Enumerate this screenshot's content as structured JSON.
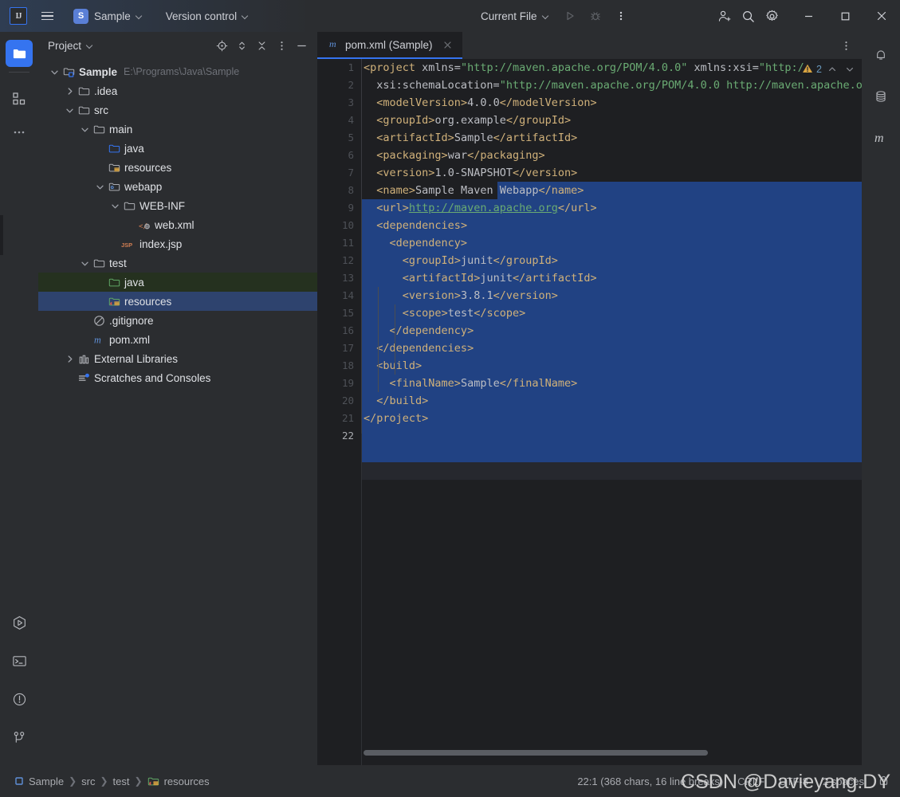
{
  "titlebar": {
    "logo_icon": "intellij-idea-logo",
    "menu_icon": "hamburger-menu-icon",
    "project_badge": "S",
    "project_name": "Sample",
    "version_control": "Version control",
    "run_config": "Current File",
    "run_icon": "run-icon",
    "debug_icon": "debug-icon",
    "more_icon": "more-vertical-icon",
    "add_user_icon": "add-user-icon",
    "search_icon": "search-icon",
    "settings_icon": "gear-icon",
    "minimize_icon": "minimize-icon",
    "maximize_icon": "maximize-icon",
    "close_icon": "close-icon"
  },
  "left_rail": {
    "top": [
      {
        "name": "project",
        "icon": "folder-icon",
        "active": true
      },
      {
        "name": "structure",
        "icon": "structure-squares-icon",
        "active": false
      },
      {
        "name": "more-tools",
        "icon": "more-horizontal-icon",
        "active": false
      }
    ],
    "bottom": [
      {
        "name": "run",
        "icon": "run-hexagon-icon"
      },
      {
        "name": "terminal",
        "icon": "terminal-icon"
      },
      {
        "name": "problems",
        "icon": "problems-warning-icon"
      },
      {
        "name": "version-control",
        "icon": "git-branch-icon"
      }
    ]
  },
  "project_panel": {
    "title": "Project",
    "title_chevron": "chevron-down-icon",
    "actions": [
      {
        "name": "select-opened-file",
        "icon": "crosshair-icon"
      },
      {
        "name": "expand-collapse",
        "icon": "expand-collapse-icon"
      },
      {
        "name": "collapse-all",
        "icon": "collapse-all-icon"
      },
      {
        "name": "options",
        "icon": "more-vertical-icon"
      },
      {
        "name": "hide",
        "icon": "minimize-icon"
      }
    ],
    "tree": [
      {
        "label": "Sample",
        "sub": "E:\\Programs\\Java\\Sample",
        "indent": 0,
        "arrow": "down",
        "icon": "module-folder-icon",
        "bold": true,
        "state": ""
      },
      {
        "label": ".idea",
        "sub": "",
        "indent": 1,
        "arrow": "right",
        "icon": "folder-icon",
        "bold": false,
        "state": ""
      },
      {
        "label": "src",
        "sub": "",
        "indent": 1,
        "arrow": "down",
        "icon": "folder-icon",
        "bold": false,
        "state": ""
      },
      {
        "label": "main",
        "sub": "",
        "indent": 2,
        "arrow": "down",
        "icon": "folder-icon",
        "bold": false,
        "state": ""
      },
      {
        "label": "java",
        "sub": "",
        "indent": 3,
        "arrow": "none",
        "icon": "source-root-icon",
        "bold": false,
        "state": ""
      },
      {
        "label": "resources",
        "sub": "",
        "indent": 3,
        "arrow": "none",
        "icon": "resource-root-icon",
        "bold": false,
        "state": ""
      },
      {
        "label": "webapp",
        "sub": "",
        "indent": 3,
        "arrow": "down",
        "icon": "webapp-root-icon",
        "bold": false,
        "state": ""
      },
      {
        "label": "WEB-INF",
        "sub": "",
        "indent": 4,
        "arrow": "down",
        "icon": "folder-icon",
        "bold": false,
        "state": ""
      },
      {
        "label": "web.xml",
        "sub": "",
        "indent": 5,
        "arrow": "none",
        "icon": "xml-file-icon",
        "bold": false,
        "state": ""
      },
      {
        "label": "index.jsp",
        "sub": "",
        "indent": 4,
        "arrow": "none",
        "icon": "jsp-file-icon",
        "bold": false,
        "state": ""
      },
      {
        "label": "test",
        "sub": "",
        "indent": 2,
        "arrow": "down",
        "icon": "folder-icon",
        "bold": false,
        "state": ""
      },
      {
        "label": "java",
        "sub": "",
        "indent": 3,
        "arrow": "none",
        "icon": "test-source-root-icon",
        "bold": false,
        "state": "testroot"
      },
      {
        "label": "resources",
        "sub": "",
        "indent": 3,
        "arrow": "none",
        "icon": "test-resource-root-icon",
        "bold": false,
        "state": "selected"
      },
      {
        "label": ".gitignore",
        "sub": "",
        "indent": 2,
        "arrow": "none",
        "icon": "gitignore-file-icon",
        "bold": false,
        "state": ""
      },
      {
        "label": "pom.xml",
        "sub": "",
        "indent": 2,
        "arrow": "none",
        "icon": "maven-file-icon",
        "bold": false,
        "state": ""
      },
      {
        "label": "External Libraries",
        "sub": "",
        "indent": 1,
        "arrow": "right",
        "icon": "libraries-icon",
        "bold": false,
        "state": ""
      },
      {
        "label": "Scratches and Consoles",
        "sub": "",
        "indent": 1,
        "arrow": "none",
        "icon": "scratches-icon",
        "bold": false,
        "state": ""
      }
    ]
  },
  "editor": {
    "tab_label": "pom.xml (Sample)",
    "tab_icon": "maven-file-icon",
    "tab_close_icon": "close-icon",
    "options_icon": "more-vertical-icon",
    "warning_count": "2",
    "warning_icon": "warning-triangle-icon",
    "prev_icon": "chevron-up-icon",
    "next_icon": "chevron-down-icon",
    "line_numbers": [
      "1",
      "2",
      "3",
      "4",
      "5",
      "6",
      "7",
      "8",
      "9",
      "10",
      "11",
      "12",
      "13",
      "14",
      "15",
      "16",
      "17",
      "18",
      "19",
      "20",
      "21",
      "22"
    ],
    "current_line": 22,
    "code": [
      "<project xmlns=\"http://maven.apache.org/POM/4.0.0\" xmlns:xsi=\"http:/",
      "  xsi:schemaLocation=\"http://maven.apache.org/POM/4.0.0 http://maven.apache.or",
      "  <modelVersion>4.0.0</modelVersion>",
      "  <groupId>org.example</groupId>",
      "  <artifactId>Sample</artifactId>",
      "  <packaging>war</packaging>",
      "  <version>1.0-SNAPSHOT</version>",
      "  <name>Sample Maven Webapp</name>",
      "  <url>http://maven.apache.org</url>",
      "  <dependencies>",
      "    <dependency>",
      "      <groupId>junit</groupId>",
      "      <artifactId>junit</artifactId>",
      "      <version>3.8.1</version>",
      "      <scope>test</scope>",
      "    </dependency>",
      "  </dependencies>",
      "  <build>",
      "    <finalName>Sample</finalName>",
      "  </build>",
      "</project>",
      ""
    ]
  },
  "right_rail": [
    {
      "name": "notifications",
      "icon": "bell-icon"
    },
    {
      "name": "database",
      "icon": "database-icon"
    },
    {
      "name": "maven",
      "icon": "maven-m-icon"
    }
  ],
  "statusbar": {
    "breadcrumbs": [
      {
        "label": "Sample",
        "icon": "module-icon"
      },
      {
        "label": "src",
        "icon": ""
      },
      {
        "label": "test",
        "icon": ""
      },
      {
        "label": "resources",
        "icon": "test-resource-root-icon"
      }
    ],
    "caret_position": "22:1 (368 chars, 16 line breaks)",
    "line_separator": "CRLF",
    "encoding": "UTF-8",
    "indent": "2 spaces",
    "lock_icon": "lock-icon",
    "watermark": "CSDN @Davieyang.DY"
  },
  "colors": {
    "accent": "#3574f0",
    "selection": "#214283",
    "test_root": "#25311f",
    "tree_selected": "#2e436e",
    "panel_bg": "#2b2d30",
    "editor_bg": "#1e1f22",
    "tag": "#d0b17a",
    "attr": "#c77dbb",
    "string": "#6aab73",
    "text": "#bcbec4"
  }
}
